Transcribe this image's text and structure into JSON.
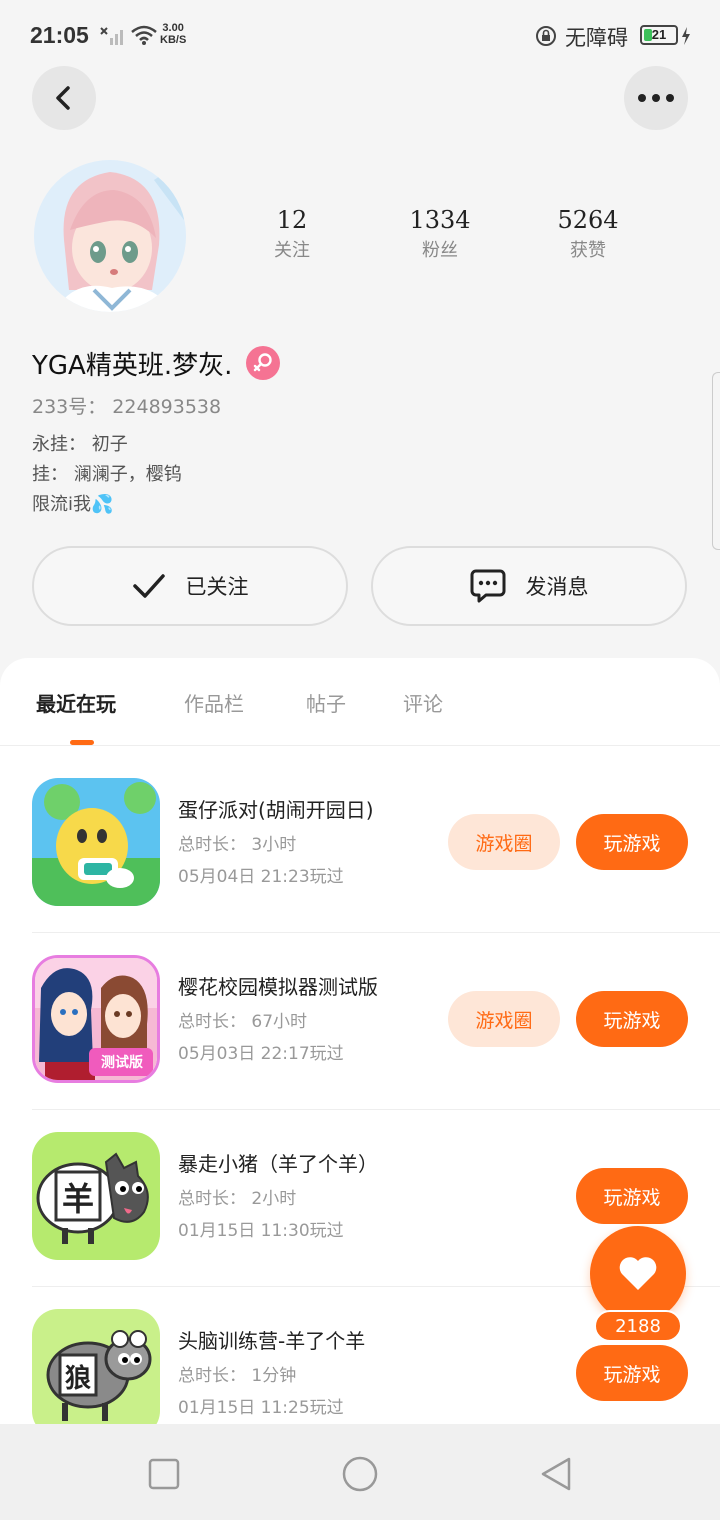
{
  "status_bar": {
    "time": "21:05",
    "speed_value": "3.00",
    "speed_unit": "KB/S",
    "accessibility": "无障碍",
    "battery": "21"
  },
  "profile": {
    "stats": [
      {
        "value": "12",
        "label": "关注"
      },
      {
        "value": "1334",
        "label": "粉丝"
      },
      {
        "value": "5264",
        "label": "获赞"
      }
    ],
    "username": "YGA精英班.梦灰.",
    "uid": "233号： 224893538",
    "bio_lines": [
      "永挂： 初子",
      "挂： 澜澜子，樱钨",
      "限流i我💦"
    ]
  },
  "actions": {
    "follow_label": "已关注",
    "message_label": "发消息"
  },
  "tabs": [
    "最近在玩",
    "作品栏",
    "帖子",
    "评论"
  ],
  "games": [
    {
      "name": "蛋仔派对(胡闹开园日)",
      "duration": "总时长： 3小时",
      "last_played": "05月04日 21:23玩过",
      "circle_label": "游戏圈",
      "play_label": "玩游戏"
    },
    {
      "name": "樱花校园模拟器测试版",
      "duration": "总时长： 67小时",
      "last_played": "05月03日 22:17玩过",
      "circle_label": "游戏圈",
      "play_label": "玩游戏",
      "icon_badge": "测试版"
    },
    {
      "name": "暴走小猪（羊了个羊）",
      "duration": "总时长： 2小时",
      "last_played": "01月15日 11:30玩过",
      "play_label": "玩游戏",
      "icon_char": "羊"
    },
    {
      "name": "头脑训练营-羊了个羊",
      "duration": "总时长： 1分钟",
      "last_played": "01月15日 11:25玩过",
      "play_label": "玩游戏",
      "icon_char": "狼"
    }
  ],
  "like": {
    "count": "2188"
  },
  "colors": {
    "accent": "#ff6a14",
    "accent_light": "#fee6d7",
    "gender": "#f57393"
  },
  "icons": [
    "back-arrow-icon",
    "more-dots-icon",
    "female-icon",
    "check-icon",
    "message-bubble-icon",
    "heart-icon",
    "nav-square-icon",
    "nav-circle-icon",
    "nav-triangle-icon"
  ]
}
